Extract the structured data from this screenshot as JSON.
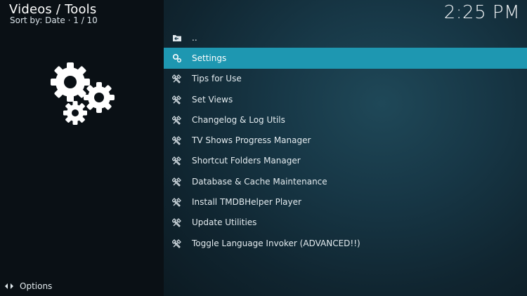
{
  "header": {
    "title": "Videos / Tools",
    "sort_info": "Sort by: Date  ·  1 / 10"
  },
  "clock": "2:25 PM",
  "list": [
    {
      "label": "..",
      "icon": "folder-back-icon",
      "selected": false
    },
    {
      "label": "Settings",
      "icon": "settings-icon",
      "selected": true
    },
    {
      "label": "Tips for Use",
      "icon": "tools-icon",
      "selected": false
    },
    {
      "label": "Set Views",
      "icon": "tools-icon",
      "selected": false
    },
    {
      "label": "Changelog & Log Utils",
      "icon": "tools-icon",
      "selected": false
    },
    {
      "label": "TV Shows Progress Manager",
      "icon": "tools-icon",
      "selected": false
    },
    {
      "label": "Shortcut Folders Manager",
      "icon": "tools-icon",
      "selected": false
    },
    {
      "label": "Database & Cache Maintenance",
      "icon": "tools-icon",
      "selected": false
    },
    {
      "label": "Install TMDBHelper Player",
      "icon": "tools-icon",
      "selected": false
    },
    {
      "label": "Update Utilities",
      "icon": "tools-icon",
      "selected": false
    },
    {
      "label": "Toggle Language Invoker (ADVANCED!!)",
      "icon": "tools-icon",
      "selected": false
    }
  ],
  "footer": {
    "options_label": "Options"
  },
  "colors": {
    "accent": "#1e97b1",
    "background": "#0a1015"
  }
}
